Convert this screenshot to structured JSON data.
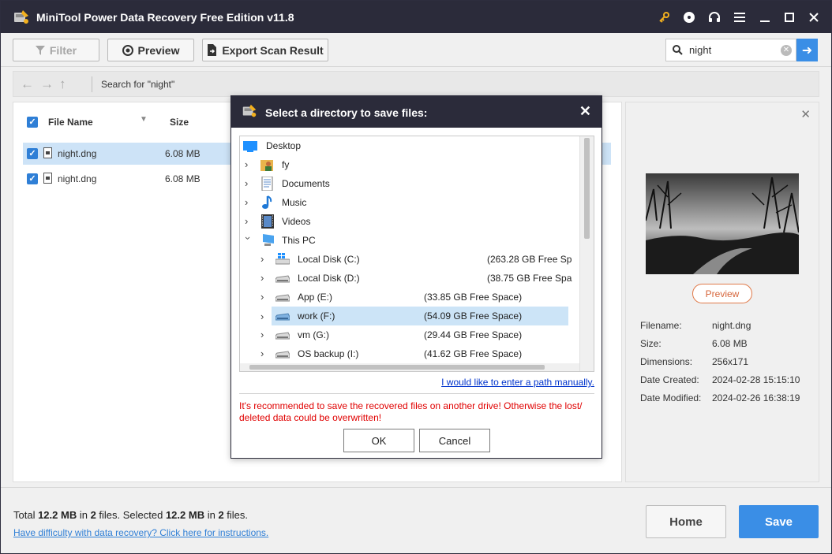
{
  "window": {
    "title": "MiniTool Power Data Recovery Free Edition v11.8",
    "icons": [
      "key-icon",
      "disc-icon",
      "headset-icon",
      "menu-icon",
      "minimize-icon",
      "maximize-icon",
      "close-icon"
    ]
  },
  "toolbar": {
    "filter_label": "Filter",
    "preview_label": "Preview",
    "export_label": "Export Scan Result",
    "search_value": "night"
  },
  "nav": {
    "path": "Search for  \"night\""
  },
  "file_list": {
    "columns": [
      "File Name",
      "Size"
    ],
    "rows": [
      {
        "name": "night.dng",
        "size": "6.08 MB"
      },
      {
        "name": "night.dng",
        "size": "6.08 MB"
      }
    ]
  },
  "preview_panel": {
    "preview_button": "Preview",
    "meta": [
      {
        "key": "Filename:",
        "value": "night.dng"
      },
      {
        "key": "Size:",
        "value": "6.08 MB"
      },
      {
        "key": "Dimensions:",
        "value": "256x171"
      },
      {
        "key": "Date Created:",
        "value": "2024-02-28 15:15:10"
      },
      {
        "key": "Date Modified:",
        "value": "2024-02-26 16:38:19"
      }
    ]
  },
  "bottom": {
    "totals_prefix": "Total ",
    "total_size": "12.2 MB",
    "in1": " in ",
    "total_files": "2",
    "files1": " files.  Selected ",
    "sel_size": "12.2 MB",
    "in2": " in ",
    "sel_files": "2",
    "files2": " files.",
    "help_link": "Have difficulty with data recovery? Click here for instructions.",
    "home_label": "Home",
    "save_label": "Save"
  },
  "dialog": {
    "title": "Select a directory to save files:",
    "tree": [
      {
        "label": "Desktop",
        "free": ""
      },
      {
        "label": "fy",
        "free": ""
      },
      {
        "label": "Documents",
        "free": ""
      },
      {
        "label": "Music",
        "free": ""
      },
      {
        "label": "Videos",
        "free": ""
      },
      {
        "label": "This PC",
        "free": ""
      },
      {
        "label": "Local Disk (C:)",
        "free": "(263.28 GB Free Sp"
      },
      {
        "label": "Local Disk (D:)",
        "free": "(38.75 GB Free Spa"
      },
      {
        "label": "App (E:)",
        "free": "(33.85 GB Free Space)"
      },
      {
        "label": "work (F:)",
        "free": "(54.09 GB Free Space)"
      },
      {
        "label": "vm (G:)",
        "free": "(29.44 GB Free Space)"
      },
      {
        "label": "OS backup (I:)",
        "free": "(41.62 GB Free Space)"
      }
    ],
    "manual_link": "I would like to enter a path manually.",
    "warning": "It's recommended to save the recovered files on another drive! Otherwise the lost/ deleted data could be overwritten!",
    "ok_label": "OK",
    "cancel_label": "Cancel"
  },
  "colors": {
    "titlebar": "#2b2b3a",
    "accent": "#3a8ee6",
    "warning": "#e00000",
    "selection": "#cce4f7"
  }
}
